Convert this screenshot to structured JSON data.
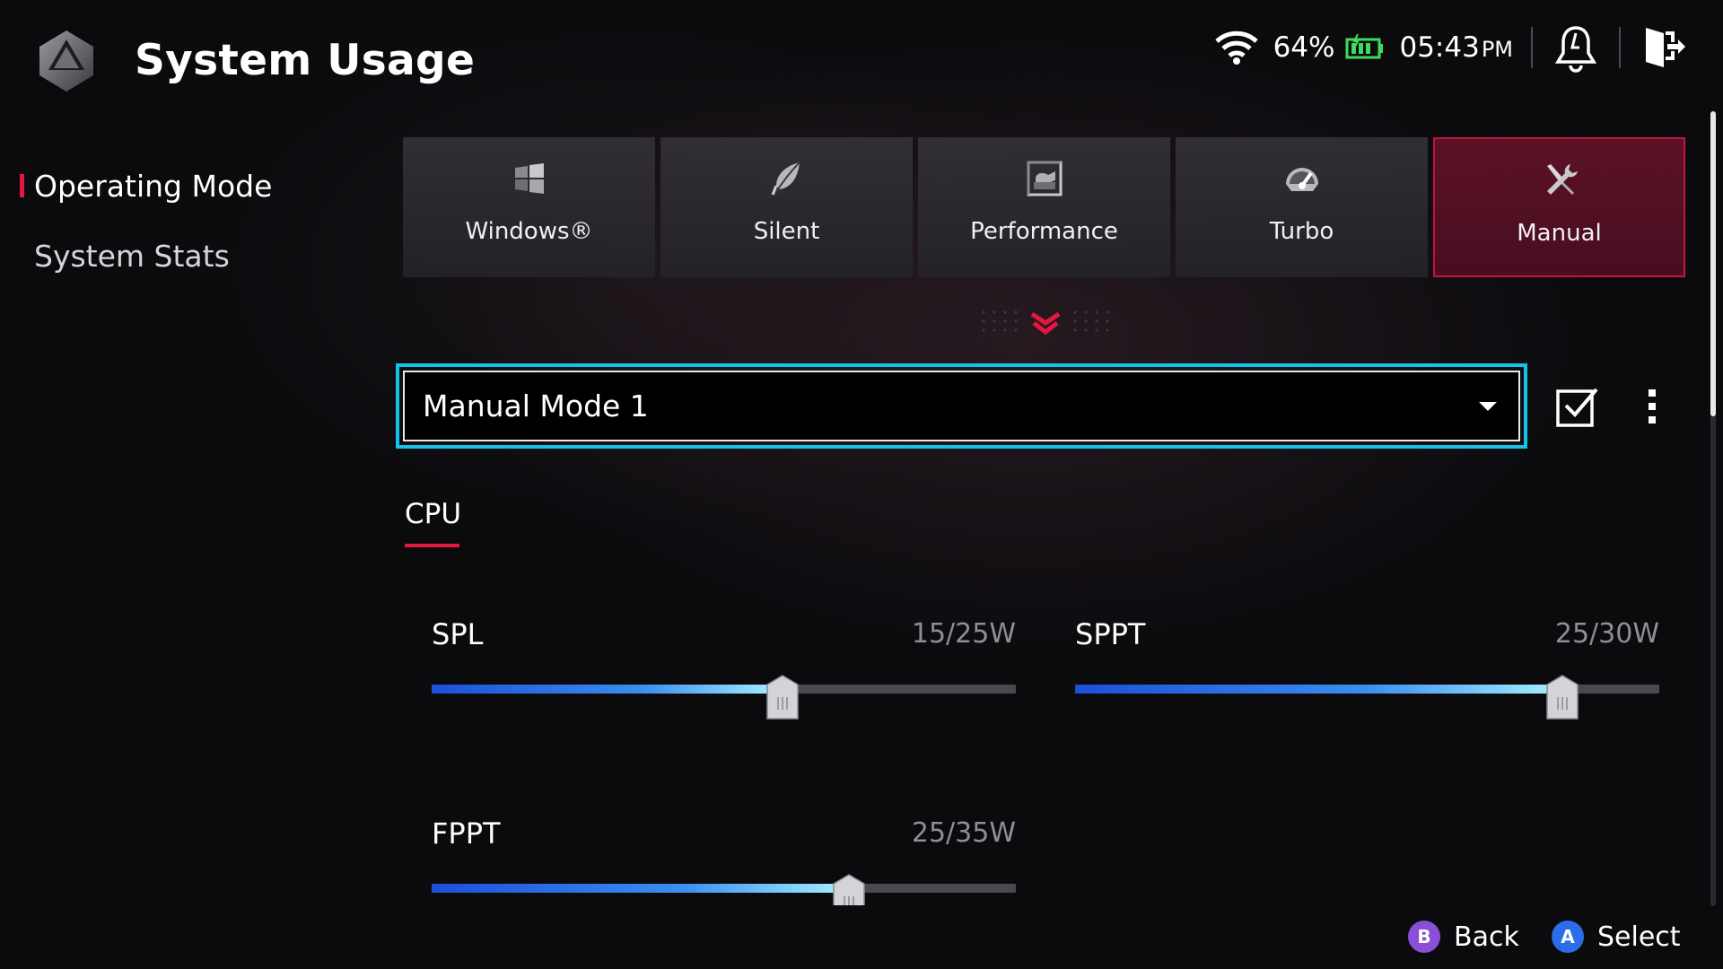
{
  "header": {
    "title": "System Usage",
    "logo_icon": "armoury-crate-logo-icon",
    "status": {
      "wifi_icon": "wifi-icon",
      "battery_percent": "64%",
      "battery_icon": "battery-charging-icon",
      "time": "05:43",
      "ampm": "PM"
    },
    "notifications_icon": "notification-bell-icon",
    "exit_icon": "exit-icon"
  },
  "sidebar": {
    "items": [
      {
        "label": "Operating Mode",
        "active": true
      },
      {
        "label": "System Stats",
        "active": false
      }
    ]
  },
  "modes": [
    {
      "label": "Windows®",
      "icon": "windows-icon",
      "selected": false
    },
    {
      "label": "Silent",
      "icon": "leaf-icon",
      "selected": false
    },
    {
      "label": "Performance",
      "icon": "performance-icon",
      "selected": false
    },
    {
      "label": "Turbo",
      "icon": "speedometer-icon",
      "selected": false
    },
    {
      "label": "Manual",
      "icon": "wrench-screwdriver-icon",
      "selected": true
    }
  ],
  "profile": {
    "selected": "Manual Mode 1",
    "apply_icon": "checkbox-check-icon",
    "more_icon": "more-vertical-icon"
  },
  "tabs": {
    "cpu": "CPU"
  },
  "sliders": {
    "spl": {
      "label": "SPL",
      "value": "15/25W",
      "current": 15,
      "max": 25
    },
    "sppt": {
      "label": "SPPT",
      "value": "25/30W",
      "current": 25,
      "max": 30
    },
    "fppt": {
      "label": "FPPT",
      "value": "25/35W",
      "current": 25,
      "max": 35
    }
  },
  "footer": {
    "back_label": "Back",
    "back_button_glyph": "B",
    "select_label": "Select",
    "select_button_glyph": "A"
  },
  "colors": {
    "accent": "#e5173f",
    "focus": "#16c3e8",
    "selected_tile": "#6a1232",
    "back_button": "#8a4fd6",
    "select_button": "#2b6de8"
  }
}
